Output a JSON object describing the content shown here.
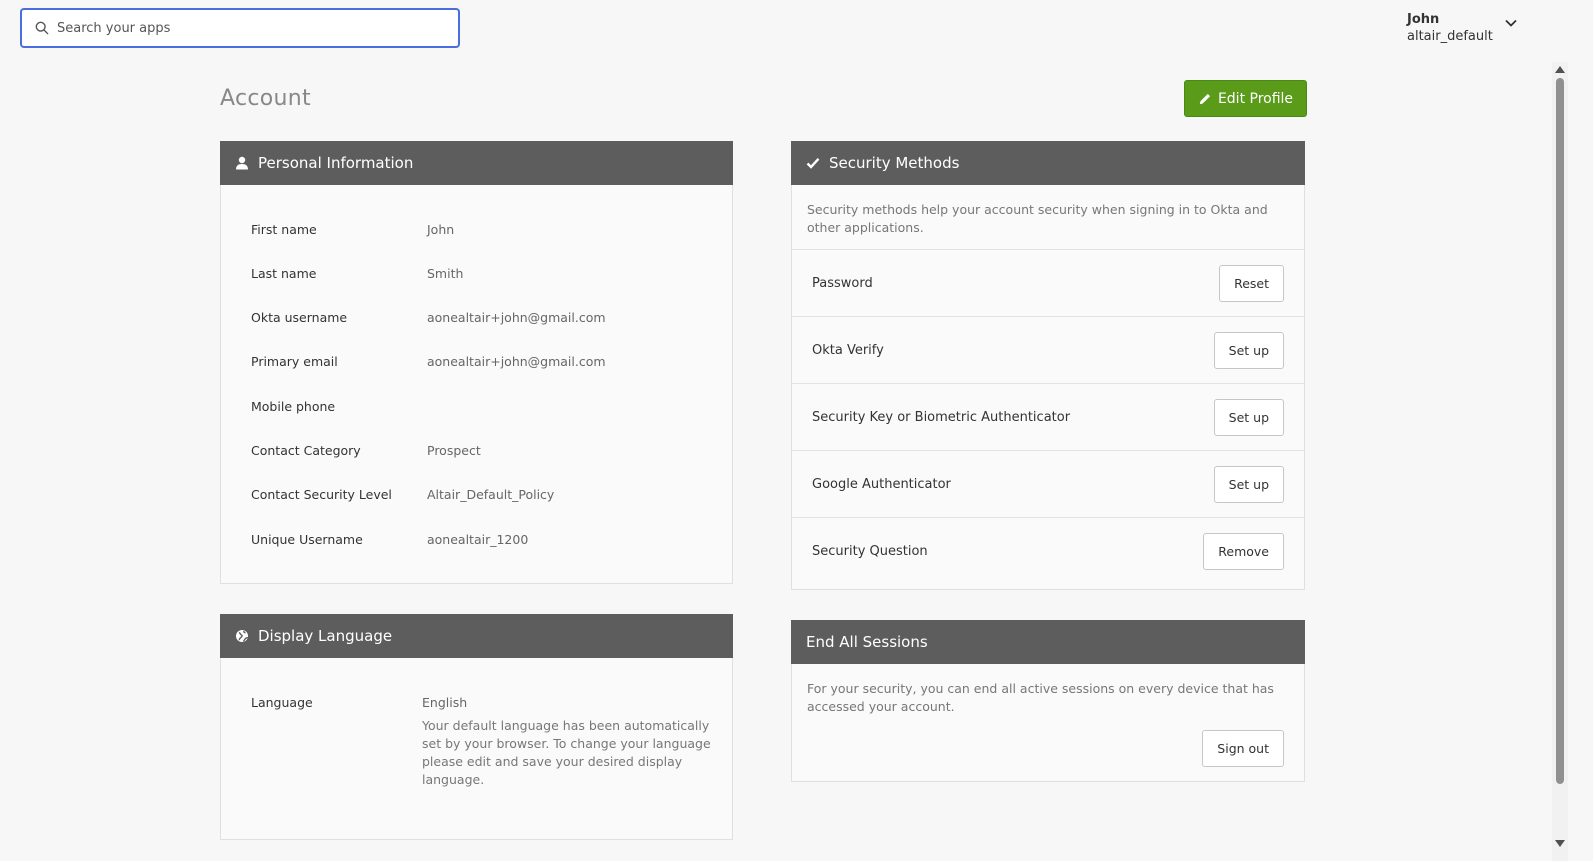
{
  "search": {
    "placeholder": "Search your apps",
    "value": ""
  },
  "user": {
    "name": "John",
    "org": "altair_default"
  },
  "page": {
    "title": "Account",
    "edit_button": "Edit Profile"
  },
  "personal": {
    "title": "Personal Information",
    "fields": [
      {
        "label": "First name",
        "value": "John"
      },
      {
        "label": "Last name",
        "value": "Smith"
      },
      {
        "label": "Okta username",
        "value": "aonealtair+john@gmail.com"
      },
      {
        "label": "Primary email",
        "value": "aonealtair+john@gmail.com"
      },
      {
        "label": "Mobile phone",
        "value": ""
      },
      {
        "label": "Contact Category",
        "value": "Prospect"
      },
      {
        "label": "Contact Security Level",
        "value": "Altair_Default_Policy"
      },
      {
        "label": "Unique Username",
        "value": "aonealtair_1200"
      }
    ]
  },
  "language": {
    "title": "Display Language",
    "label": "Language",
    "value": "English",
    "help": "Your default language has been automatically set by your browser. To change your language please edit and save your desired display language."
  },
  "security": {
    "title": "Security Methods",
    "description": "Security methods help your account security when signing in to Okta and other applications.",
    "methods": [
      {
        "label": "Password",
        "action": "Reset"
      },
      {
        "label": "Okta Verify",
        "action": "Set up"
      },
      {
        "label": "Security Key or Biometric Authenticator",
        "action": "Set up"
      },
      {
        "label": "Google Authenticator",
        "action": "Set up"
      },
      {
        "label": "Security Question",
        "action": "Remove"
      }
    ]
  },
  "sessions": {
    "title": "End All Sessions",
    "description": "For your security, you can end all active sessions on every device that has accessed your account.",
    "action": "Sign out"
  },
  "colors": {
    "accent": "#5a9c1a",
    "header": "#5d5d5d",
    "focus": "#4a6ee0"
  },
  "icons": {
    "search": "search-icon",
    "chevron": "chevron-down-icon",
    "edit": "pencil-icon",
    "personal": "user-icon",
    "language": "globe-icon",
    "security": "checkmark-icon"
  }
}
